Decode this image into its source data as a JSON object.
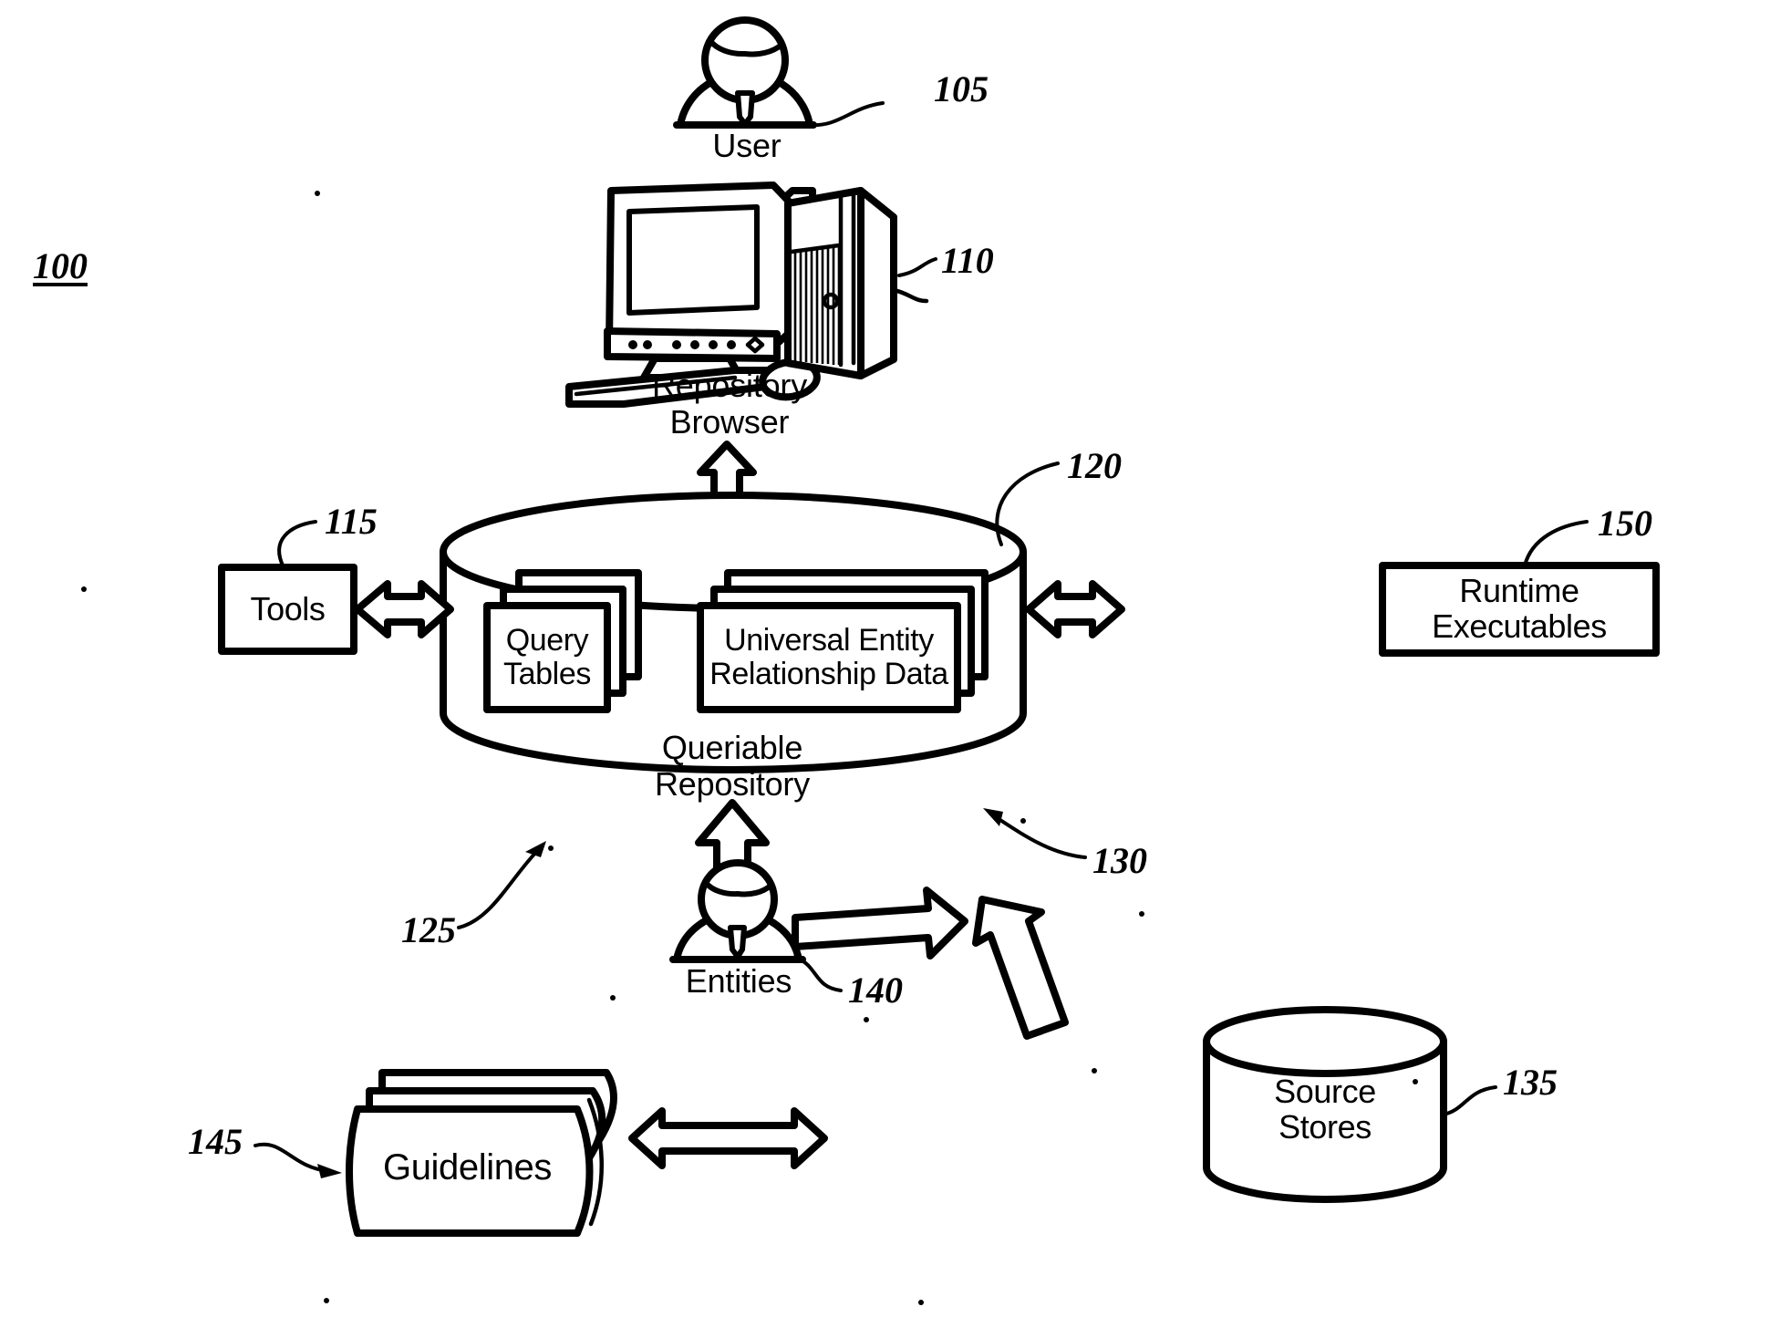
{
  "figure": {
    "number": "100",
    "title_present": false
  },
  "nodes": {
    "user": {
      "label": "User",
      "ref": "105",
      "icon": "person-icon"
    },
    "workstation": {
      "label": "Repository\nBrowser",
      "ref": "110",
      "icon": "desktop-computer-icon"
    },
    "tools": {
      "label": "Tools",
      "ref": "115"
    },
    "repository": {
      "label": "Queriable\nRepository",
      "ref": "120",
      "icon": "database-cylinder-icon"
    },
    "query_tables": {
      "label": "Query\nTables",
      "ref": "125",
      "icon": "card-stack-icon"
    },
    "uer_data": {
      "label": "Universal Entity\nRelationship Data",
      "ref": "130",
      "icon": "card-stack-icon"
    },
    "source_stores": {
      "label": "Source\nStores",
      "ref": "135",
      "icon": "database-cylinder-icon"
    },
    "entities": {
      "label": "Entities",
      "ref": "140",
      "icon": "person-icon"
    },
    "guidelines": {
      "label": "Guidelines",
      "ref": "145",
      "icon": "book-stack-icon"
    },
    "runtime_executables": {
      "label": "Runtime\nExecutables",
      "ref": "150"
    }
  },
  "connectors": [
    {
      "name": "browser-to-repository",
      "style": "double-headed-vertical-arrow"
    },
    {
      "name": "tools-to-repository",
      "style": "double-headed-horizontal-arrow"
    },
    {
      "name": "repository-to-runtime",
      "style": "double-headed-horizontal-arrow"
    },
    {
      "name": "entities-to-repository",
      "style": "single-up-arrow"
    },
    {
      "name": "entities-to-source-stores",
      "style": "single-right-arrow"
    },
    {
      "name": "source-stores-to-repository",
      "style": "single-diagonal-up-arrow"
    },
    {
      "name": "guidelines-to-entities",
      "style": "double-headed-horizontal-arrow"
    }
  ],
  "colors": {
    "ink": "#000000",
    "paper": "#ffffff"
  }
}
